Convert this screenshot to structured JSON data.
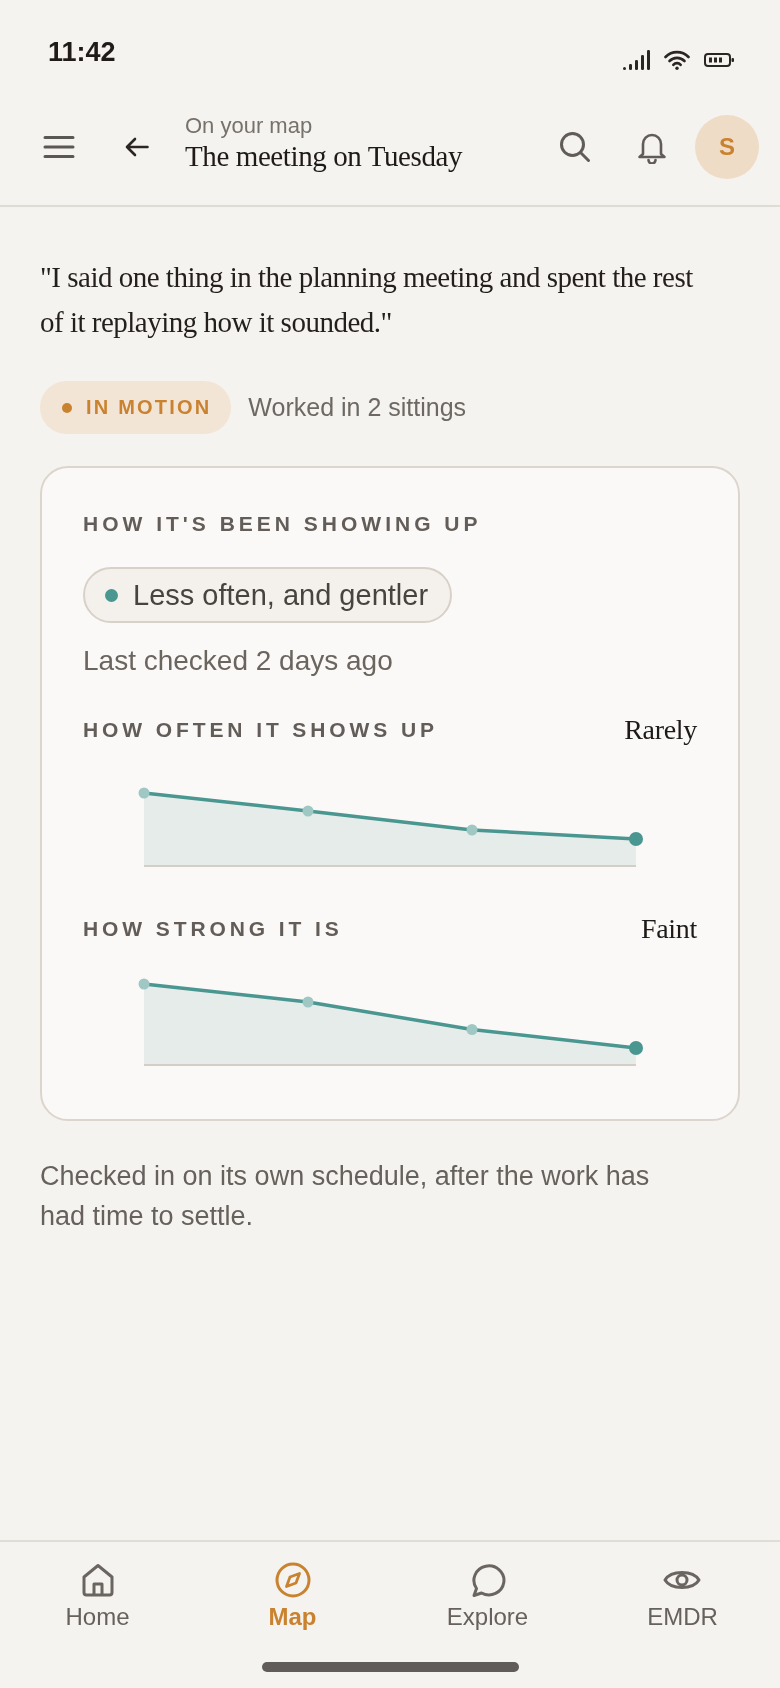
{
  "status_bar": {
    "time": "11:42"
  },
  "header": {
    "subtitle": "On your map",
    "title": "The meeting on Tuesday",
    "avatar": "S"
  },
  "quote": "\"I said one thing in the planning meeting and spent the rest of it replaying how it sounded.\"",
  "status": {
    "badge": "IN MOTION",
    "note": "Worked in 2 sittings"
  },
  "card": {
    "title": "HOW IT'S BEEN SHOWING UP",
    "trend": "Less often, and gentler",
    "last_checked": "Last checked 2 days ago",
    "metrics": [
      {
        "label": "HOW OFTEN IT SHOWS UP",
        "reading": "Rarely"
      },
      {
        "label": "HOW STRONG IT IS",
        "reading": "Faint"
      }
    ]
  },
  "footnote": "Checked in on its own schedule, after the work has had time to settle.",
  "nav": [
    {
      "label": "Home",
      "selected": false
    },
    {
      "label": "Map",
      "selected": true
    },
    {
      "label": "Explore",
      "selected": false
    },
    {
      "label": "EMDR",
      "selected": false
    }
  ]
}
